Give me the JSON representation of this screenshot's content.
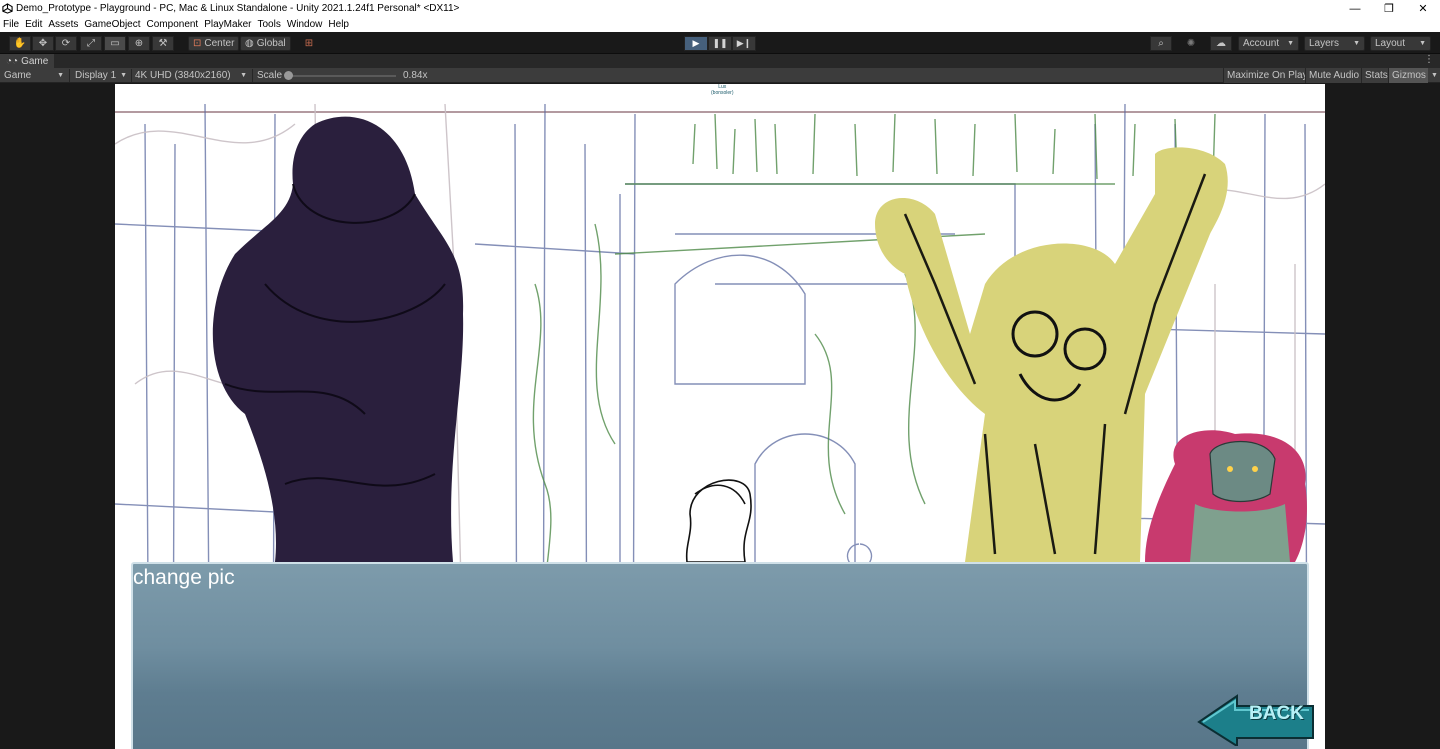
{
  "window": {
    "title": "Demo_Prototype - Playground - PC, Mac & Linux Standalone - Unity 2021.1.24f1 Personal* <DX11>",
    "controls": {
      "minimize": "—",
      "restore": "❐",
      "close": "✕"
    }
  },
  "menu": [
    "File",
    "Edit",
    "Assets",
    "GameObject",
    "Component",
    "PlayMaker",
    "Tools",
    "Window",
    "Help"
  ],
  "toolbar": {
    "pivot_label": "Center",
    "space_label": "Global",
    "account_label": "Account",
    "layers_label": "Layers",
    "layout_label": "Layout"
  },
  "tab": {
    "label": "Game"
  },
  "game_toolbar": {
    "view_mode": "Game",
    "display": "Display 1",
    "resolution": "4K UHD (3840x2160)",
    "scale_label": "Scale",
    "scale_value": "0.84x",
    "scale_fraction": 0.0,
    "maximize_label": "Maximize On Play",
    "mute_label": "Mute Audio",
    "stats_label": "Stats",
    "gizmos_label": "Gizmos"
  },
  "scene": {
    "dialog_text": "change pic",
    "back_button_label": "BACK",
    "tiny_label_line1": "Lux",
    "tiny_label_line2": "(bonsoler)"
  },
  "colors": {
    "editor_bg": "#191919",
    "play_active": "#46607c",
    "dialog_top": "#7d9bab",
    "dialog_bottom": "#587689",
    "back_button": "#1c7f8a",
    "silhouette_dark": "#2a1f3d",
    "silhouette_yellow": "#d8d37a"
  }
}
